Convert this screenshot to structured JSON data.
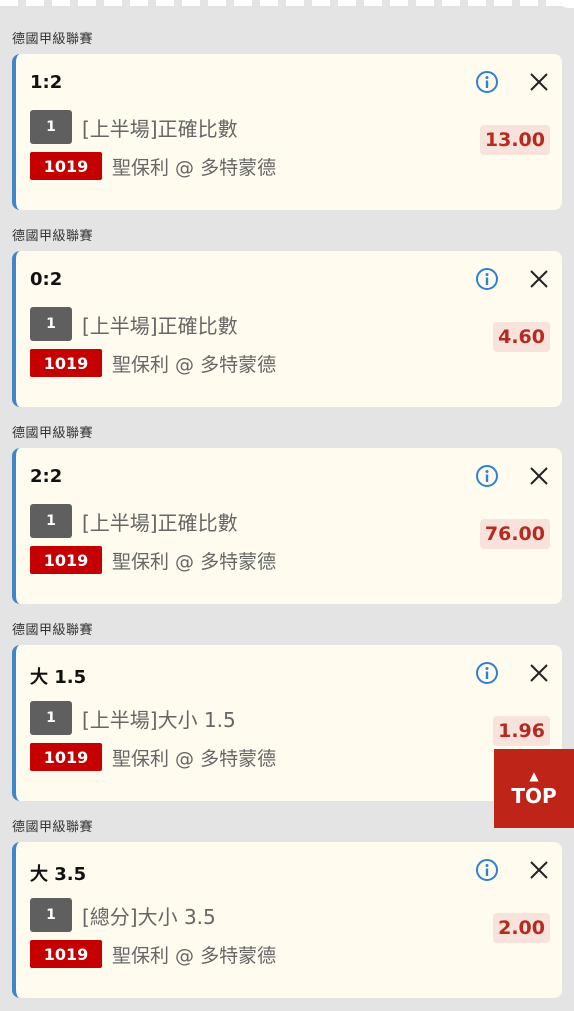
{
  "bets": [
    {
      "league": "德國甲級聯賽",
      "selection": "1:2",
      "leg": "1",
      "market": "[上半場]正確比數",
      "match_no": "1019",
      "teams": "聖保利 @ 多特蒙德",
      "odds": "13.00"
    },
    {
      "league": "德國甲級聯賽",
      "selection": "0:2",
      "leg": "1",
      "market": "[上半場]正確比數",
      "match_no": "1019",
      "teams": "聖保利 @ 多特蒙德",
      "odds": "4.60"
    },
    {
      "league": "德國甲級聯賽",
      "selection": "2:2",
      "leg": "1",
      "market": "[上半場]正確比數",
      "match_no": "1019",
      "teams": "聖保利 @ 多特蒙德",
      "odds": "76.00"
    },
    {
      "league": "德國甲級聯賽",
      "selection": "大 1.5",
      "leg": "1",
      "market": "[上半場]大小 1.5",
      "match_no": "1019",
      "teams": "聖保利 @ 多特蒙德",
      "odds": "1.96"
    },
    {
      "league": "德國甲級聯賽",
      "selection": "大 3.5",
      "leg": "1",
      "market": "[總分]大小 3.5",
      "match_no": "1019",
      "teams": "聖保利 @ 多特蒙德",
      "odds": "2.00"
    }
  ],
  "top_button": {
    "label": "TOP",
    "arrow": "▲"
  },
  "icons": {
    "info": "info-icon",
    "close": "close-icon"
  },
  "colors": {
    "accent_border": "#3f86c8",
    "info_icon": "#2f7fd6",
    "match_badge": "#c40000",
    "leg_badge": "#5f5f5f",
    "odds_text": "#b52b1f",
    "odds_bg": "#f7e2dc",
    "top_button": "#bf2418",
    "card_bg": "#fffcef"
  }
}
